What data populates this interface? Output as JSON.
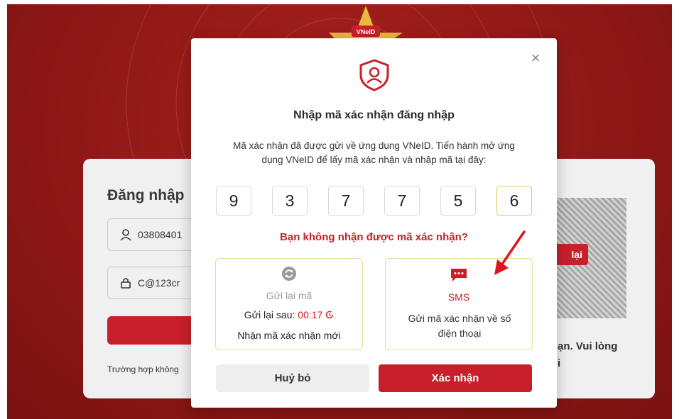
{
  "background": {
    "logo_text": "VNeID",
    "login_title": "Đăng nhập",
    "username_value": "03808401",
    "password_value": "C@123cr",
    "help_text": "Trường hợp không",
    "qr_button_label": "lại",
    "side_text_line1": "ạn. Vui lòng",
    "side_text_line2": "i"
  },
  "modal": {
    "close_symbol": "×",
    "title": "Nhập mã xác nhận đăng nhập",
    "description": "Mã xác nhận đã được gửi về ứng dụng VNeID. Tiến hành mở ứng dụng VNeID để lấy mã xác nhận và nhập mã tại đây:",
    "otp_digits": [
      "9",
      "3",
      "7",
      "7",
      "5",
      "6"
    ],
    "not_received_prompt": "Bạn không nhận được mã xác nhận?",
    "resend_option": {
      "icon": "refresh-icon",
      "label": "Gửi lại mã",
      "timer_prefix": "Gửi lại sau:",
      "timer_value": "00:17",
      "subtitle": "Nhận mã xác nhận mới"
    },
    "sms_option": {
      "icon": "sms-chat-icon",
      "label": "SMS",
      "description": "Gửi mã xác nhận về số điện thoại"
    },
    "cancel_label": "Huỷ bỏ",
    "confirm_label": "Xác nhận"
  },
  "colors": {
    "brand_red": "#c8202a",
    "background_red": "#8f1816",
    "option_border": "#ecd79c"
  }
}
